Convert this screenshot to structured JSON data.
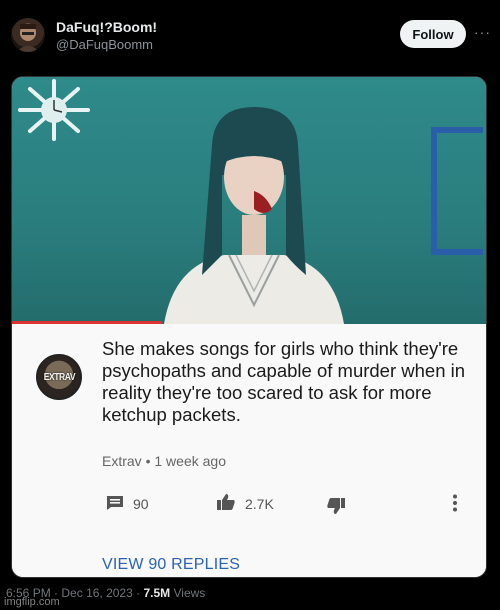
{
  "post": {
    "display_name": "DaFuq!?Boom!",
    "handle": "@DaFuqBoomm",
    "follow_label": "Follow",
    "more_label": "···"
  },
  "comment": {
    "channel_avatar_text": "EXTRAV",
    "text": "She makes songs for girls who think they're psychopaths and capable of murder when in reality they're too scared to ask for more ketchup packets.",
    "author": "Extrav",
    "separator": "•",
    "age": "1 week ago",
    "reply_count": "90",
    "like_count": "2.7K",
    "view_replies_label": "VIEW 90 REPLIES"
  },
  "footer": {
    "time": "6:56 PM",
    "dot1": "·",
    "date": "Dec 16, 2023",
    "dot2": "·",
    "views_count": "7.5M",
    "views_label": "Views"
  },
  "watermark": "imgflip.com",
  "colors": {
    "background": "#000000",
    "follow_bg": "#eff3f4",
    "link_blue": "#2a62b4",
    "scene_teal": "#2f8a8a"
  }
}
